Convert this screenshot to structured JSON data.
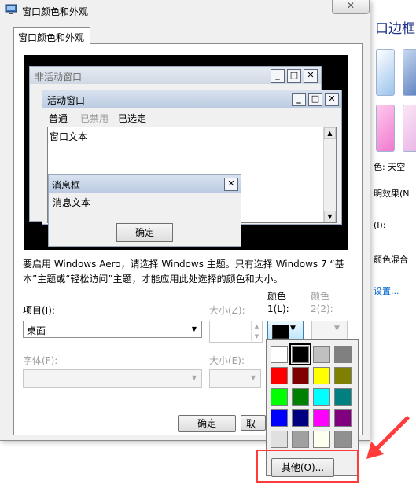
{
  "window": {
    "title": "窗口颜色和外观",
    "close_glyph": "✕"
  },
  "tab": {
    "label": "窗口颜色和外观"
  },
  "preview": {
    "inactive_title": "非活动窗口",
    "active_title": "活动窗口",
    "menu": [
      "普通",
      "已禁用",
      "已选定"
    ],
    "window_text": "窗口文本",
    "msgbox_title": "消息框",
    "msgbox_text": "消息文本",
    "msgbox_ok": "确定",
    "caption_buttons": [
      "_",
      "□",
      "✕"
    ]
  },
  "description": "要启用 Windows Aero，请选择 Windows 主题。只有选择 Windows 7 “基本”主题或“轻松访问”主题，才能应用此处选择的颜色和大小。",
  "item": {
    "label": "项目(I):",
    "value": "桌面"
  },
  "size1": {
    "label": "大小(Z):"
  },
  "color1": {
    "label_line1": "颜色",
    "label_line2": "1(L):"
  },
  "color2": {
    "label_line1": "颜色",
    "label_line2": "2(2):"
  },
  "font": {
    "label": "字体(F):"
  },
  "size2": {
    "label": "大小(E):"
  },
  "buttons": {
    "ok": "确定",
    "cancel_partial": "取"
  },
  "color_palette": {
    "selected": "#000000",
    "swatches": [
      "#ffffff",
      "#000000",
      "#c0c0c0",
      "#808080",
      "#ff0000",
      "#800000",
      "#ffff00",
      "#808000",
      "#00ff00",
      "#008000",
      "#00ffff",
      "#008080",
      "#0000ff",
      "#000080",
      "#ff00ff",
      "#800080",
      "#e0e0e0",
      "#a0a0a0",
      "#fffff0",
      "#909090"
    ],
    "other_button": "其他(O)..."
  },
  "background_panel": {
    "heading": "口边框",
    "text_1": "色: 天空",
    "text_2": "明效果(N",
    "text_3": "(I):",
    "text_4": "颜色混合",
    "link": "设置..."
  },
  "highlight_color": "#ff3b3b"
}
